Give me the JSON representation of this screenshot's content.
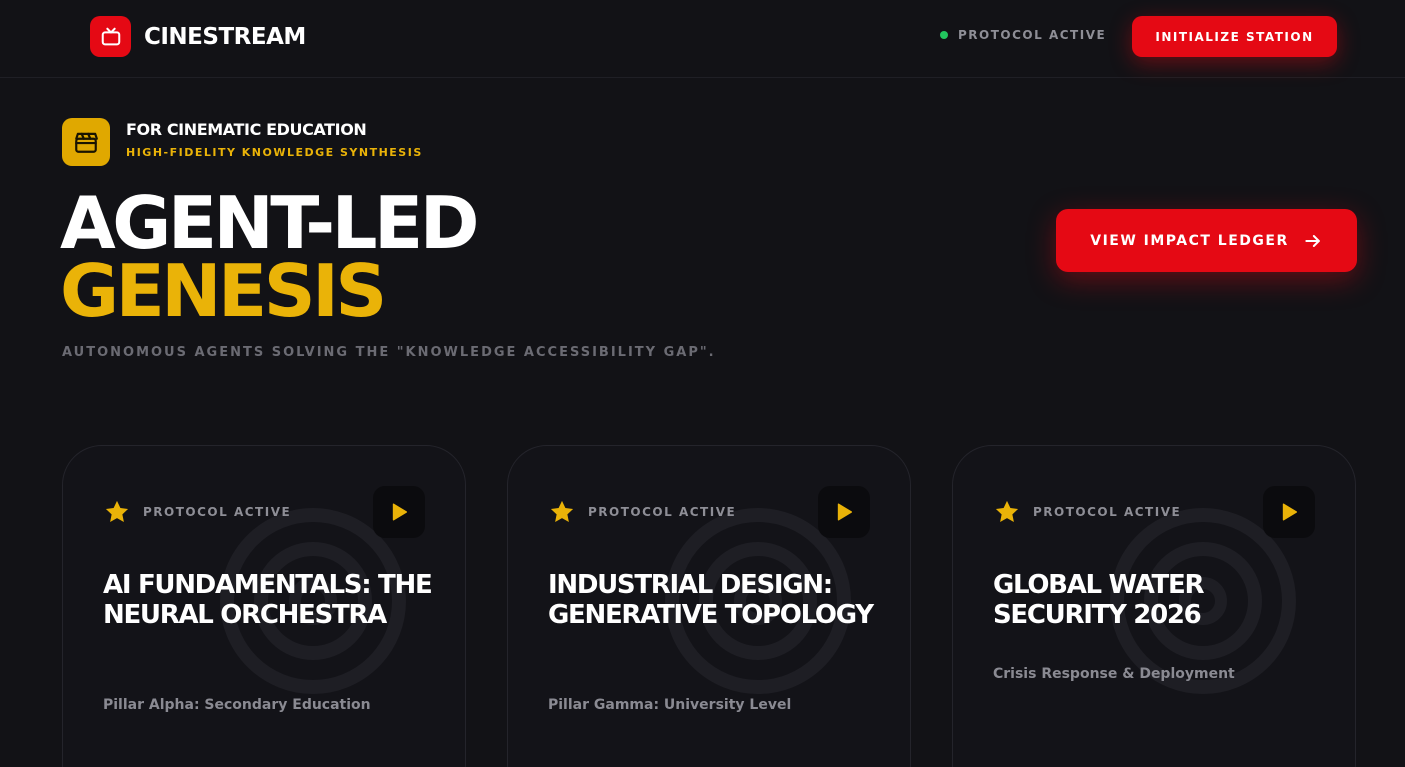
{
  "header": {
    "brand_name": "CINESTREAM",
    "brand_icon": "tv-icon",
    "status_text": "PROTOCOL ACTIVE",
    "status_color": "#22c55e",
    "cta_label": "INITIALIZE STATION"
  },
  "hero": {
    "badge_icon": "clapperboard-icon",
    "badge_title": "FOR CINEMATIC EDUCATION",
    "badge_subtitle": "HIGH-FIDELITY KNOWLEDGE SYNTHESIS",
    "title_line1": "AGENT-LED",
    "title_line2": "GENESIS",
    "description": "AUTONOMOUS AGENTS SOLVING THE \"KNOWLEDGE ACCESSIBILITY GAP\".",
    "ledger_button_label": "VIEW IMPACT LEDGER"
  },
  "cards": [
    {
      "status": "PROTOCOL ACTIVE",
      "title": "AI FUNDAMENTALS: THE NEURAL ORCHESTRA",
      "subtitle": "Pillar Alpha: Secondary Education"
    },
    {
      "status": "PROTOCOL ACTIVE",
      "title": "INDUSTRIAL DESIGN: GENERATIVE TOPOLOGY",
      "subtitle": "Pillar Gamma: University Level"
    },
    {
      "status": "PROTOCOL ACTIVE",
      "title": "GLOBAL WATER SECURITY 2026",
      "subtitle": "Crisis Response & Deployment"
    }
  ],
  "colors": {
    "accent_red": "#e50914",
    "accent_gold": "#eab308",
    "background": "#121216"
  }
}
